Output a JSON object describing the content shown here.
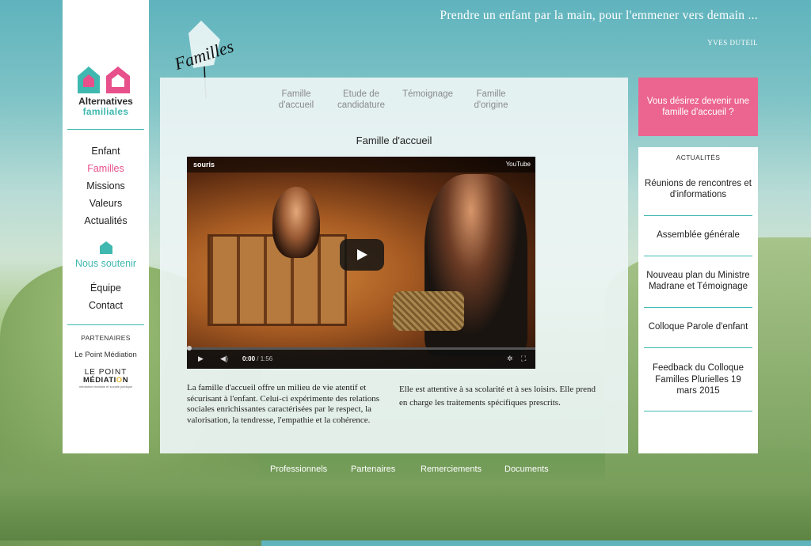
{
  "quote": {
    "text": "Prendre un enfant par la main, pour l'emmener vers demain ...",
    "author": "YVES DUTEIL"
  },
  "brand": {
    "line1": "Alternatives",
    "line2": "familiales",
    "familles_logo": "Familles",
    "house_colors": [
      "#3fb8b0",
      "#e7508a"
    ]
  },
  "sidebar": {
    "nav_top": [
      "Enfant",
      "Familles",
      "Missions",
      "Valeurs",
      "Actualités"
    ],
    "active": "Familles",
    "support": "Nous soutenir",
    "nav_bottom": [
      "Équipe",
      "Contact"
    ],
    "partners_title": "PARTENAIRES",
    "partner_link": "Le Point Médiation",
    "partner_logo": {
      "line1": "LE POINT",
      "line2_a": "MÉDIATI",
      "line2_o": "O",
      "line2_b": "N",
      "tagline": "médiation familiale et sociale juridique"
    }
  },
  "main": {
    "tabs": [
      {
        "label": "Famille\nd'accueil"
      },
      {
        "label": "Etude de\ncandidature"
      },
      {
        "label": "Témoignage"
      },
      {
        "label": "Famille\nd'origine"
      }
    ],
    "section_title": "Famille d'accueil",
    "video": {
      "title": "souris",
      "provider": "YouTube",
      "time_current": "0:00",
      "time_total": "1:56",
      "progress": 0
    },
    "col1": "La famille d'accueil offre un milieu de vie atentif et sécurisant à l'enfant. Celui-ci expérimente des relations sociales enrichissantes caractérisées par le respect, la valorisation, la tendresse, l'empathie et la cohérence.",
    "col2": "Elle est attentive à sa scolarité et à ses loisirs. Elle prend en charge les traitements spécifiques prescrits."
  },
  "right": {
    "cta": "Vous désirez devenir une famille d'accueil ?",
    "news_title": "ACTUALITÉS",
    "news": [
      "Réunions de rencontres et d'informations",
      "Assemblée générale",
      "Nouveau plan du Ministre Madrane et Témoignage",
      "Colloque Parole d'enfant",
      "Feedback du Colloque Familles Plurielles 19 mars 2015"
    ]
  },
  "footer": {
    "links": [
      "Professionnels",
      "Partenaires",
      "Remerciements",
      "Documents"
    ]
  }
}
